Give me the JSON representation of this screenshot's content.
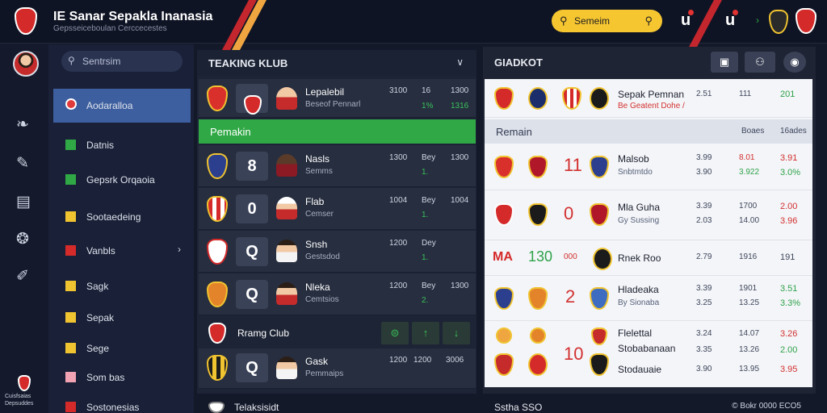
{
  "header": {
    "title": "IE Sanar Sepakla Inanasia",
    "subtitle": "Gepsseiceboulan Cerccecestes",
    "search_placeholder": "Semeim",
    "icon1": "u",
    "icon2": "u"
  },
  "rail": {
    "icons": [
      "fire-icon",
      "pencil-icon",
      "image-icon",
      "gamepad-icon",
      "chat-icon"
    ],
    "glyphs": [
      "❧",
      "✎",
      "▤",
      "❂",
      "✐"
    ],
    "bottom_label": "Cuisfsaias Depsuddes"
  },
  "sidebar": {
    "search_placeholder": "Sentrsim",
    "items": [
      {
        "label": "Aodaralloa",
        "color": "#e23b3b",
        "active": true,
        "chevron": false
      },
      {
        "label": "Datnis",
        "color": "#2fa845",
        "active": false,
        "chevron": false
      },
      {
        "label": "Gepsrk Orqaoia",
        "color": "#2fa845",
        "active": false,
        "chevron": false
      },
      {
        "label": "Sootaedeing",
        "color": "#f0c330",
        "active": false,
        "chevron": false
      },
      {
        "label": "Vanbls",
        "color": "#d42a2a",
        "active": false,
        "chevron": true
      },
      {
        "label": "Sagk",
        "color": "#f0c330",
        "active": false,
        "chevron": false
      },
      {
        "label": "Sepak",
        "color": "#f0c330",
        "active": false,
        "chevron": false
      },
      {
        "label": "Sege",
        "color": "#f0c330",
        "active": false,
        "chevron": false
      },
      {
        "label": "Som bas",
        "color": "#f2a3b3",
        "active": false,
        "chevron": false
      },
      {
        "label": "Sostonesias",
        "color": "#d42a2a",
        "active": false,
        "chevron": false
      }
    ]
  },
  "ranking": {
    "title": "TEAKING KLUB",
    "collapse": "∨",
    "top_row": {
      "name": "Lepalebil",
      "sub": "Beseof Pennarl",
      "v1": "3100",
      "v2": "16",
      "v3": "1300",
      "v4": "1%",
      "v5": "1316"
    },
    "group_label": "Pemakin",
    "rows": [
      {
        "tile": "8",
        "name": "Nasls",
        "sub": "Semms",
        "v1": "1300",
        "v2": "Bey",
        "v3": "1300",
        "v4": "1.",
        "v5": ""
      },
      {
        "tile": "0",
        "name": "Flab",
        "sub": "Cemser",
        "v1": "1004",
        "v2": "Bey",
        "v3": "1004",
        "v4": "1.",
        "v5": ""
      },
      {
        "tile": "Q",
        "name": "Snsh",
        "sub": "Gestsdod",
        "v1": "1200",
        "v2": "Dey",
        "v3": "",
        "v4": "1.",
        "v5": ""
      },
      {
        "tile": "Q",
        "name": "Nleka",
        "sub": "Cemtsios",
        "v1": "1200",
        "v2": "Bey",
        "v3": "1300",
        "v4": "2.",
        "v5": ""
      }
    ],
    "club_header": "Rramg Club",
    "club_buttons": [
      "⊜",
      "↑",
      "↓"
    ],
    "club_row": {
      "tile": "Q",
      "name": "Gask",
      "sub": "Pemmaips",
      "v1": "1200",
      "v2": "1200",
      "v3": "3006"
    },
    "footer": "Telaksisidt"
  },
  "panel": {
    "title": "GIADKOT",
    "buttons": [
      "▣",
      "⚇",
      "◉"
    ],
    "top": {
      "name": "Sepak Pemnan",
      "sub": "Be Geatent Dohe /",
      "a": "2.51",
      "b": "111",
      "c": "201"
    },
    "section": "Remain",
    "col_a": "Boaes",
    "col_b": "16ades",
    "rows": [
      {
        "big": "11",
        "name": "Malsob",
        "sub": "Snbtmtdo",
        "a1": "3.99",
        "a2": "3.90",
        "b1": "8.01",
        "b2": "3.922",
        "c1": "3.91",
        "c2": "3.0%"
      },
      {
        "big": "0",
        "name": "Mla Guha",
        "sub": "Gy Sussing",
        "a1": "3.39",
        "a2": "2.03",
        "b1": "1700",
        "b2": "14.00",
        "c1": "2.00",
        "c2": "3.96"
      },
      {
        "big": "130",
        "name": "Rnek Roo",
        "sub": "",
        "a1": "2.79",
        "a2": "",
        "b1": "1916",
        "b2": "",
        "c1": "191",
        "c2": ""
      },
      {
        "big": "2",
        "name": "Hladeaka",
        "sub": "By Sionaba",
        "a1": "3.39",
        "a2": "3.25",
        "b1": "1901",
        "b2": "13.25",
        "c1": "3.51",
        "c2": "3.3%"
      },
      {
        "big": "10",
        "name": "Flelettal",
        "sub": "Stobabanaan",
        "a1": "3.24",
        "a2": "3.35",
        "b1": "14.07",
        "b2": "13.26",
        "c1": "3.26",
        "c2": "2.00"
      }
    ],
    "row_extra": {
      "sub3": "Stodauaie",
      "a3": "3.90",
      "b3": "13.95",
      "c3": "3.95",
      "left": "000"
    },
    "footer_left": "Sstha SSO",
    "footer_right": "© Bokr 0000 ECO5"
  }
}
